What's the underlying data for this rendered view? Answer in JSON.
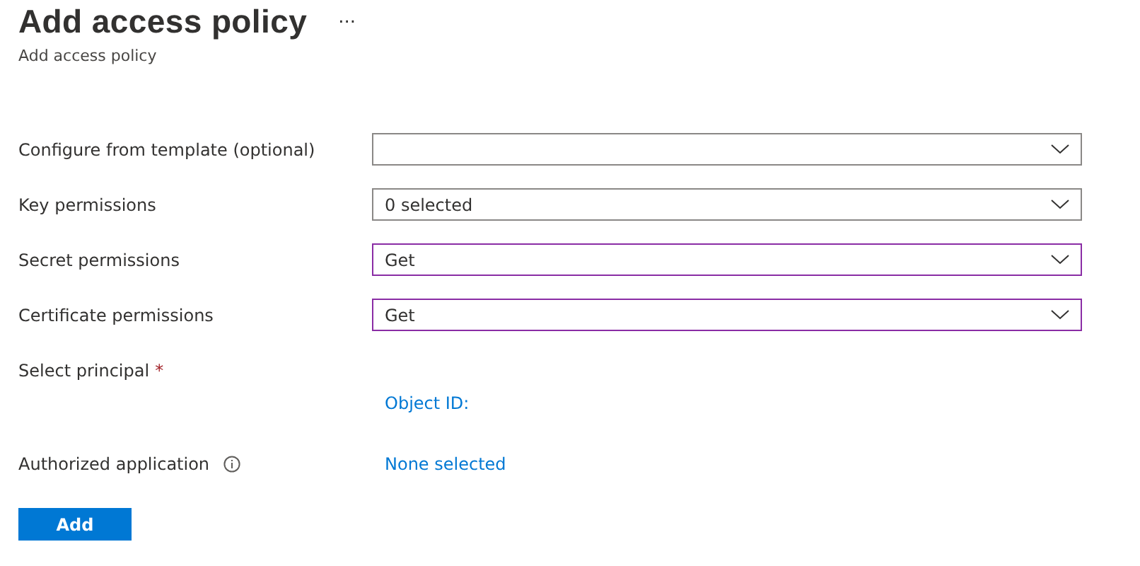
{
  "header": {
    "title": "Add access policy",
    "more": "...",
    "subtitle": "Add access policy"
  },
  "dropdowns": [
    {
      "label": "Configure from template (optional)",
      "modified": false
    },
    {
      "label": "Key permissions",
      "value": "0 selected",
      "modified": false
    },
    {
      "label": "Secret permissions",
      "value": "Get",
      "modified": true
    },
    {
      "label": "Certificate permissions",
      "value": "Get",
      "modified": true
    }
  ],
  "principal": {
    "label": "Select principal",
    "required_mark": "*",
    "link": "Object ID:"
  },
  "application": {
    "label": "Authorized application",
    "link": "None selected"
  },
  "add_button": "Add"
}
